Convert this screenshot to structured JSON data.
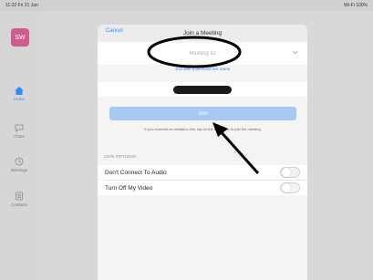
{
  "status_bar": {
    "time": "11:22 Fri 21 Jan",
    "right": "Wi-Fi 100%"
  },
  "sidebar": {
    "avatar_initials": "SW",
    "items": [
      {
        "label": "Home",
        "icon": "home-icon",
        "active": true
      },
      {
        "label": "Chats",
        "icon": "chat-bubble-icon",
        "active": false
      },
      {
        "label": "Meetings",
        "icon": "clock-icon",
        "active": false
      },
      {
        "label": "Contacts",
        "icon": "contacts-icon",
        "active": false
      }
    ]
  },
  "modal": {
    "cancel_label": "Cancel",
    "title": "Join a Meeting",
    "meeting_id_placeholder": "Meeting ID",
    "personal_link_label": "Join with a personal link name",
    "name_value": "",
    "join_label": "Join",
    "join_note": "If you received an invitation link, tap on the link again to join the meeting",
    "options_header": "JOIN OPTIONS",
    "options": [
      {
        "label": "Don't Connect To Audio",
        "on": false
      },
      {
        "label": "Turn Off My Video",
        "on": false
      }
    ]
  },
  "colors": {
    "accent": "#2d8cff",
    "join_button": "#a7c8f0",
    "avatar": "#d05b8f"
  }
}
